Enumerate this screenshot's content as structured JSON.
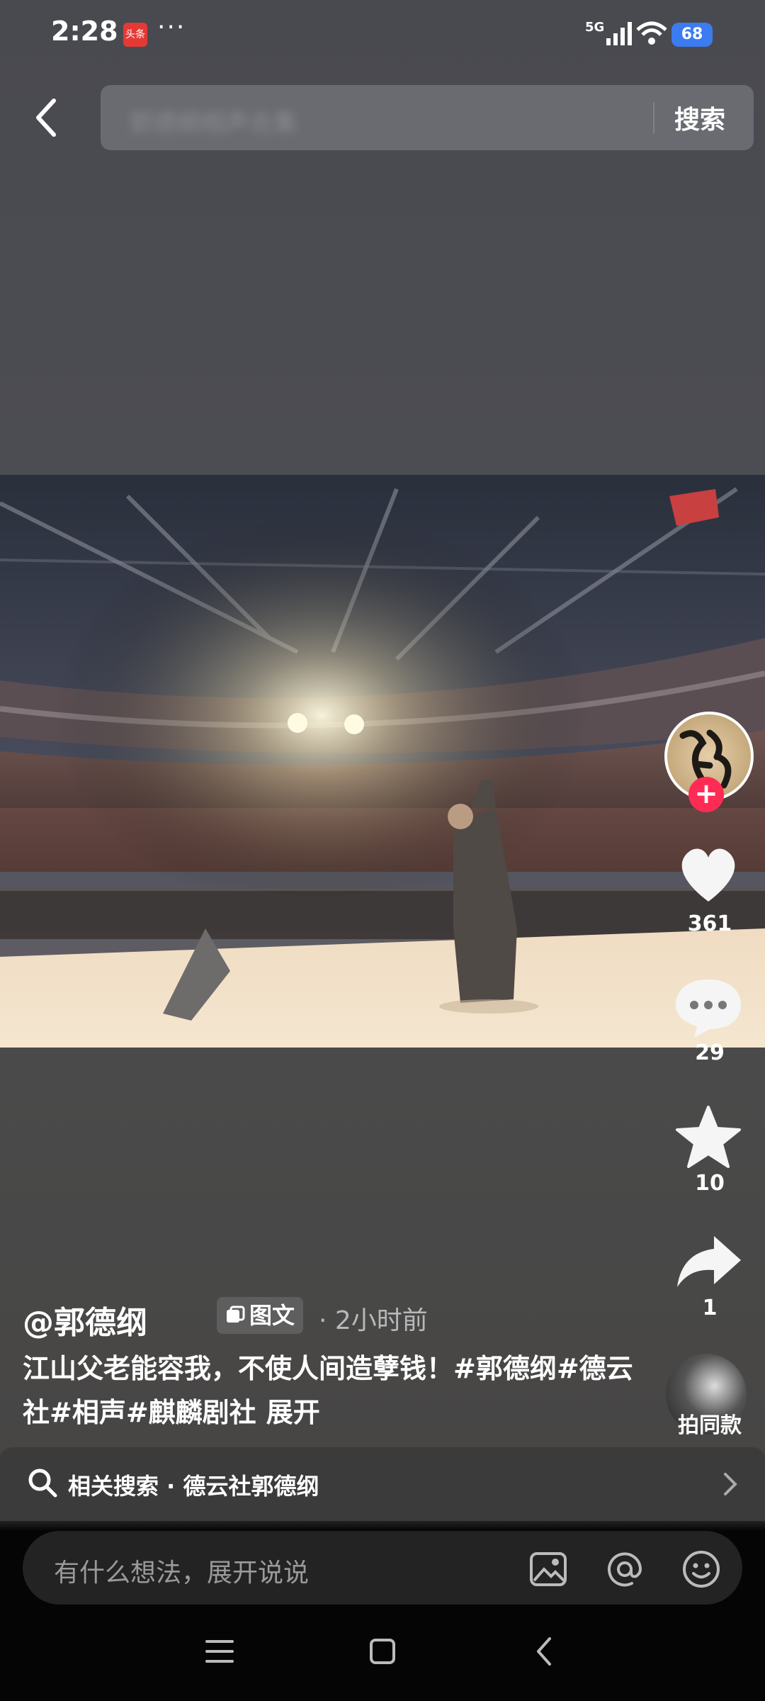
{
  "status_bar": {
    "time": "2:28",
    "app_badge": "头条",
    "more_dots": "···",
    "network": "5G",
    "battery": "68"
  },
  "header": {
    "search_button_label": "搜索",
    "search_placeholder": "郭德纲相声合集"
  },
  "post": {
    "author": "@郭德纲",
    "type_badge": "图文",
    "time": "· 2小时前",
    "caption": "江山父老能容我，不使人间造孽钱！#郭德纲#德云社#相声#麒麟剧社",
    "expand_label": "展开"
  },
  "actions": {
    "likes": "361",
    "comments": "29",
    "favorites": "10",
    "shares": "1",
    "same_style_label": "拍同款"
  },
  "related_search": {
    "label": "相关搜索 · 德云社郭德纲"
  },
  "comment_bar": {
    "placeholder": "有什么想法，展开说说"
  },
  "colors": {
    "follow_plus": "#fe2c55",
    "battery": "#3c7bf0"
  }
}
